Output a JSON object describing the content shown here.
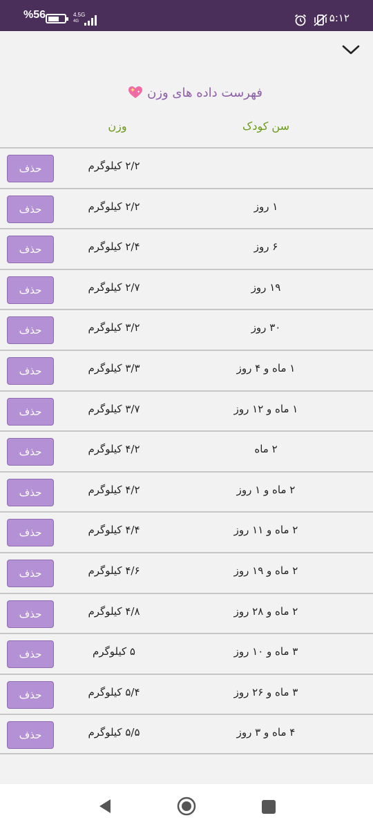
{
  "status_bar": {
    "battery_percent": "%56",
    "network_type": "4.5G",
    "network_sub": "4G",
    "time": "۵:۱۲"
  },
  "header": {
    "title": "فهرست داده های وزن",
    "col_age": "سن کودک",
    "col_weight": "وزن"
  },
  "colors": {
    "status_bar": "#4a2f5a",
    "title": "#8e5ea8",
    "column_header": "#6b9a1a",
    "delete_button": "#b391d4"
  },
  "rows": [
    {
      "age": "",
      "weight": "۲/۲ کیلوگرم",
      "delete_label": "حذف"
    },
    {
      "age": "۱ روز",
      "weight": "۲/۲ کیلوگرم",
      "delete_label": "حذف"
    },
    {
      "age": "۶ روز",
      "weight": "۲/۴ کیلوگرم",
      "delete_label": "حذف"
    },
    {
      "age": "۱۹ روز",
      "weight": "۲/۷ کیلوگرم",
      "delete_label": "حذف"
    },
    {
      "age": "۳۰ روز",
      "weight": "۳/۲ کیلوگرم",
      "delete_label": "حذف"
    },
    {
      "age": "۱ ماه و ۴ روز",
      "weight": "۳/۳ کیلوگرم",
      "delete_label": "حذف"
    },
    {
      "age": "۱ ماه و ۱۲ روز",
      "weight": "۳/۷ کیلوگرم",
      "delete_label": "حذف"
    },
    {
      "age": "۲ ماه",
      "weight": "۴/۲ کیلوگرم",
      "delete_label": "حذف"
    },
    {
      "age": "۲ ماه و ۱ روز",
      "weight": "۴/۲ کیلوگرم",
      "delete_label": "حذف"
    },
    {
      "age": "۲ ماه و ۱۱ روز",
      "weight": "۴/۴ کیلوگرم",
      "delete_label": "حذف"
    },
    {
      "age": "۲ ماه و ۱۹ روز",
      "weight": "۴/۶ کیلوگرم",
      "delete_label": "حذف"
    },
    {
      "age": "۲ ماه و ۲۸ روز",
      "weight": "۴/۸ کیلوگرم",
      "delete_label": "حذف"
    },
    {
      "age": "۳ ماه و ۱۰ روز",
      "weight": "۵ کیلوگرم",
      "delete_label": "حذف"
    },
    {
      "age": "۳ ماه و ۲۶ روز",
      "weight": "۵/۴ کیلوگرم",
      "delete_label": "حذف"
    },
    {
      "age": "۴ ماه و ۳ روز",
      "weight": "۵/۵ کیلوگرم",
      "delete_label": "حذف"
    }
  ],
  "icons": {
    "collapse": "chevron-down-icon",
    "title_emoji": "sparkling-heart-icon",
    "alarm": "alarm-icon",
    "mute": "vibrate-off-icon",
    "nav_back": "back-triangle-icon",
    "nav_home": "home-circle-icon",
    "nav_recent": "recent-apps-square-icon"
  }
}
